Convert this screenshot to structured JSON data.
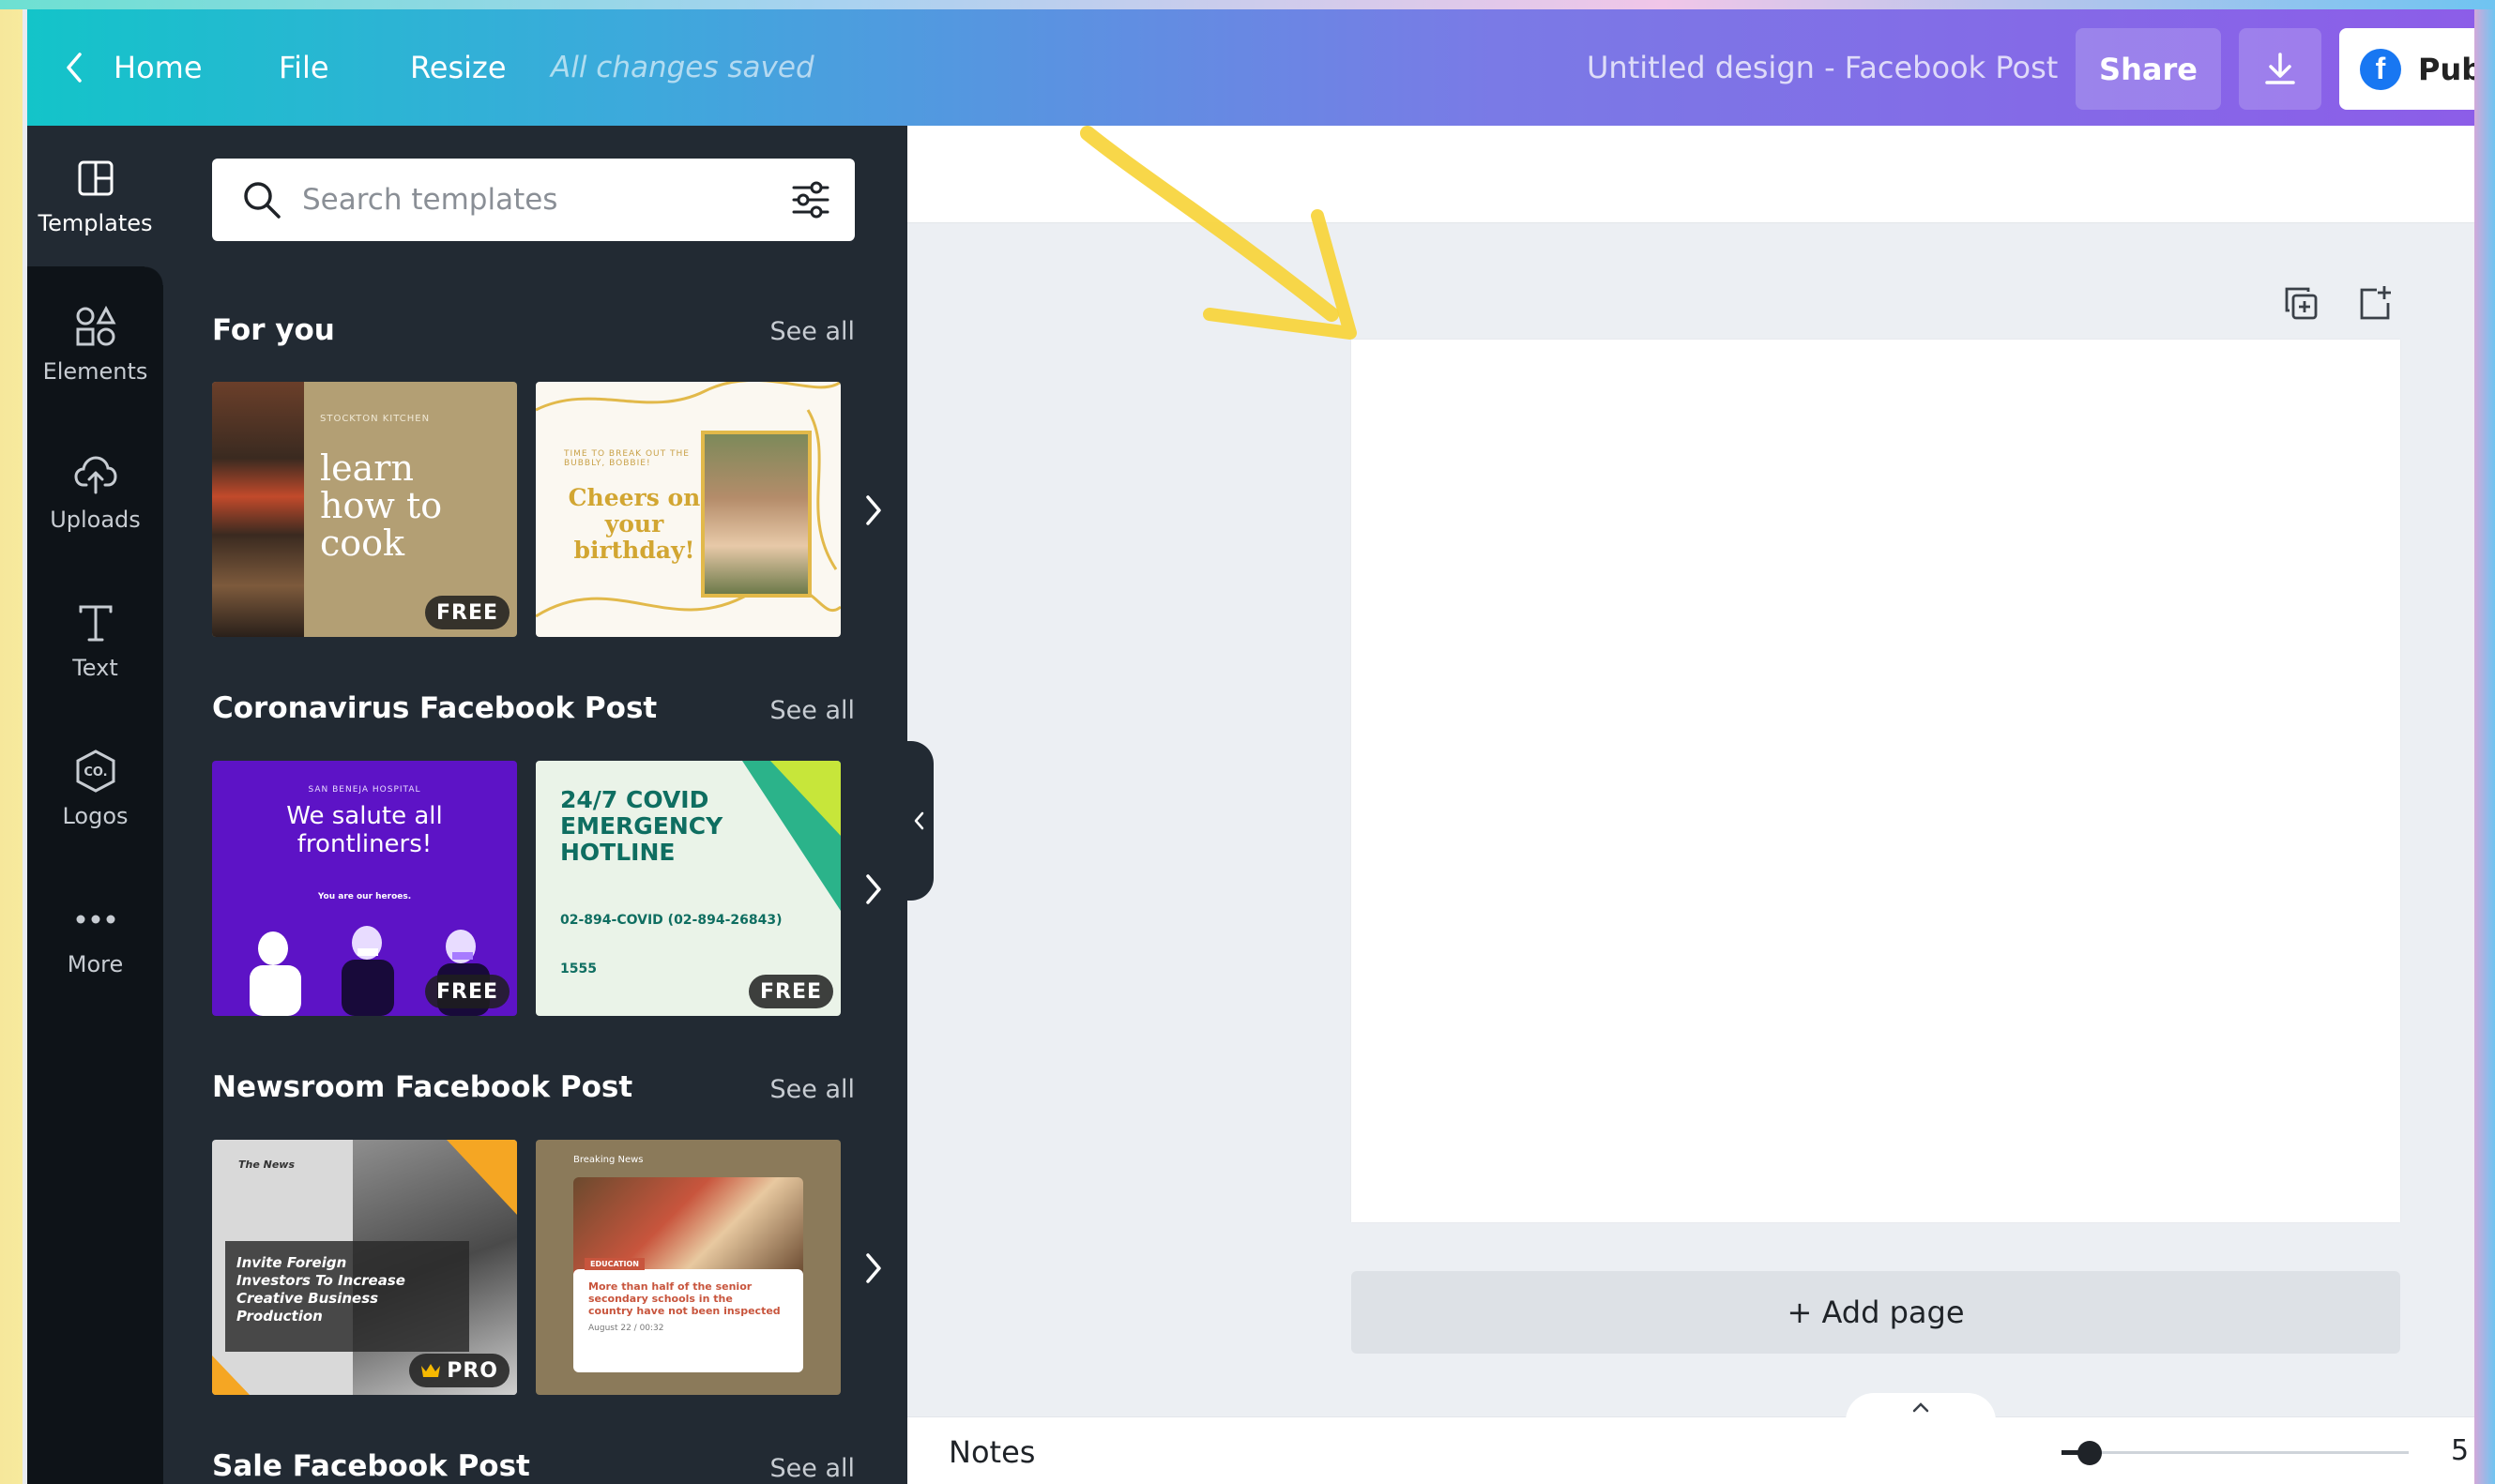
{
  "header": {
    "home_label": "Home",
    "file_label": "File",
    "resize_label": "Resize",
    "saved_status": "All changes saved",
    "document_title": "Untitled design - Facebook Post",
    "share_label": "Share",
    "publish_label": "Pub"
  },
  "rail": {
    "items": [
      {
        "label": "Templates",
        "icon": "templates-icon"
      },
      {
        "label": "Elements",
        "icon": "elements-icon"
      },
      {
        "label": "Uploads",
        "icon": "cloud-upload-icon"
      },
      {
        "label": "Text",
        "icon": "text-icon"
      },
      {
        "label": "Logos",
        "icon": "logos-icon"
      },
      {
        "label": "More",
        "icon": "more-dots-icon"
      }
    ]
  },
  "panel": {
    "search_placeholder": "Search templates",
    "sections": [
      {
        "title": "For you",
        "see_all": "See all",
        "thumbs": [
          {
            "kicker": "STOCKTON KITCHEN",
            "text": "learn how to cook",
            "badge": "FREE"
          },
          {
            "kicker": "TIME TO BREAK OUT THE BUBBLY, BOBBIE!",
            "text": "Cheers on your birthday!"
          }
        ]
      },
      {
        "title": "Coronavirus Facebook Post",
        "see_all": "See all",
        "thumbs": [
          {
            "kicker": "SAN BENEJA HOSPITAL",
            "text": "We salute all frontliners!",
            "sub": "You are our heroes.",
            "badge": "FREE"
          },
          {
            "text": "24/7 COVID EMERGENCY HOTLINE",
            "sub": "02-894-COVID (02-894-26843)",
            "sub2": "1555",
            "badge": "FREE"
          }
        ]
      },
      {
        "title": "Newsroom Facebook Post",
        "see_all": "See all",
        "thumbs": [
          {
            "kicker": "The News",
            "text": "Invite Foreign Investors To Increase Creative Business Production",
            "badge": "PRO"
          },
          {
            "kicker": "Breaking News",
            "tag": "EDUCATION",
            "text": "More than half of the senior secondary schools in the country have not been inspected",
            "sub": "August 22 / 00:32"
          }
        ]
      },
      {
        "title": "Sale Facebook Post",
        "see_all": "See all"
      }
    ]
  },
  "canvas": {
    "add_page_label": "+ Add page"
  },
  "footer": {
    "notes_label": "Notes",
    "zoom_value": "5",
    "zoom_level": 0.05
  },
  "colors": {
    "header_start": "#13c4c9",
    "header_end": "#8c5de8",
    "panel_bg": "#222a33",
    "rail_bg": "#0e1318",
    "annotation_arrow": "#f7d43a"
  }
}
